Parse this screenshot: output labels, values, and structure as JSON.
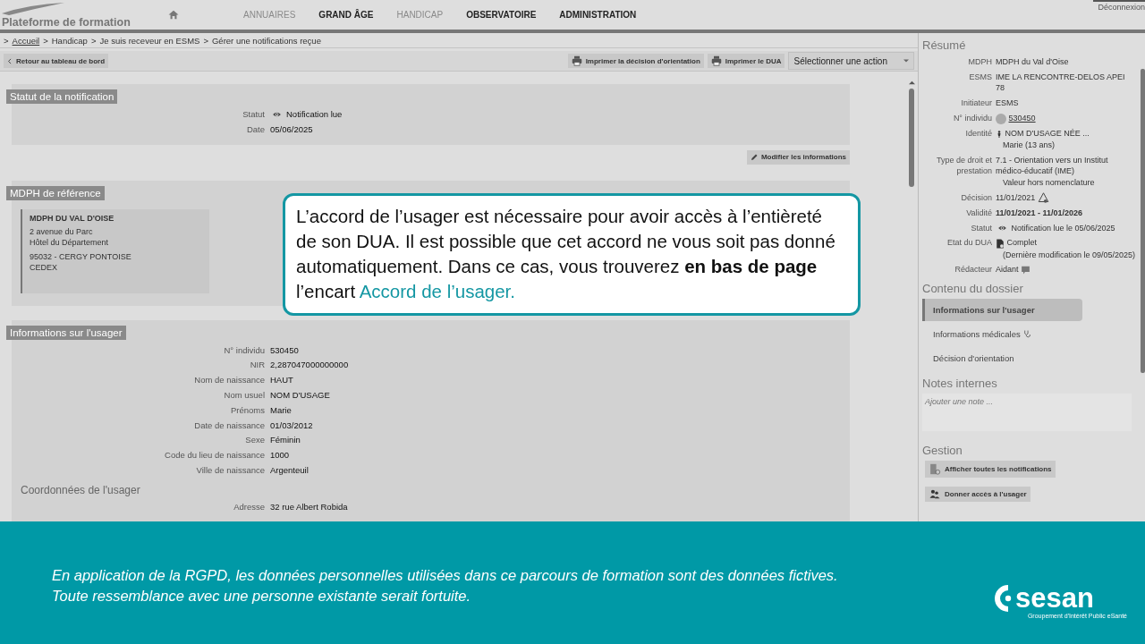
{
  "header": {
    "subtitle": "Plateforme de formation",
    "nav": [
      {
        "label": "ANNUAIRES",
        "muted": true
      },
      {
        "label": "GRAND ÂGE",
        "muted": false
      },
      {
        "label": "HANDICAP",
        "muted": true
      },
      {
        "label": "OBSERVATOIRE",
        "muted": false
      },
      {
        "label": "ADMINISTRATION",
        "muted": false
      }
    ],
    "logout": "Déconnexion"
  },
  "breadcrumb": {
    "separator": ">",
    "items": [
      {
        "label": "Accueil",
        "link": true
      },
      {
        "label": "Handicap",
        "link": false
      },
      {
        "label": "Je suis receveur en ESMS",
        "link": false
      },
      {
        "label": "Gérer une notifications reçue",
        "link": false
      }
    ]
  },
  "toolbar": {
    "back": "Retour au tableau de bord",
    "actions": [
      "Imprimer la décision d'orientation",
      "Imprimer le DUA"
    ],
    "select": "Sélectionner une action"
  },
  "sections": [
    {
      "title": "Statut de la notification",
      "kind": "fields",
      "fields": [
        {
          "kind": "eye",
          "label": "Statut",
          "value": "Notification lue"
        },
        {
          "kind": "field",
          "label": "Date",
          "value": "05/06/2025"
        }
      ],
      "button": "Modifier les informations"
    },
    {
      "title": "MDPH de référence",
      "kind": "address",
      "name": "MDPH DU VAL D'OISE",
      "lines": [
        "2 avenue du Parc",
        "Hôtel du Département",
        "95032 - CERGY PONTOISE",
        "CEDEX"
      ]
    },
    {
      "title": "Informations sur l'usager",
      "kind": "fields",
      "fields": [
        {
          "kind": "field",
          "label": "N° individu",
          "value": "530450"
        },
        {
          "kind": "field",
          "label": "NIR",
          "value": "2,287047000000000"
        },
        {
          "kind": "field",
          "label": "Nom de naissance",
          "value": "HAUT"
        },
        {
          "kind": "field",
          "label": "Nom usuel",
          "value": "NOM D'USAGE"
        },
        {
          "kind": "field",
          "label": "Prénoms",
          "value": "Marie"
        },
        {
          "kind": "field",
          "label": "Date de naissance",
          "value": "01/03/2012"
        },
        {
          "kind": "field",
          "label": "Sexe",
          "value": "Féminin"
        },
        {
          "kind": "field",
          "label": "Code du lieu de naissance",
          "value": "1000"
        },
        {
          "kind": "field",
          "label": "Ville de naissance",
          "value": "Argenteuil"
        },
        {
          "kind": "subheading",
          "label": "Coordonnées de l'usager"
        },
        {
          "kind": "field",
          "label": "Adresse",
          "value": "32 rue Albert Robida"
        }
      ]
    }
  ],
  "callout": {
    "parts": [
      {
        "kind": "plain",
        "text": "L’accord de l’usager est nécessaire pour avoir accès à l’entièreté de son DUA. Il est possible que cet accord ne vous soit pas donné automatiquement. Dans ce cas, vous trouverez "
      },
      {
        "kind": "bold",
        "text": "en bas de page"
      },
      {
        "kind": "plain",
        "text": " l’encart "
      },
      {
        "kind": "accent",
        "text": "Accord de l’usager."
      }
    ]
  },
  "sidebar": {
    "summary_title": "Résumé",
    "summary": [
      {
        "kind": "text",
        "label": "MDPH",
        "value": "MDPH du Val d'Oise"
      },
      {
        "kind": "text",
        "label": "ESMS",
        "value": "IME LA RENCONTRE-DELOS APEI 78"
      },
      {
        "kind": "text",
        "label": "Initiateur",
        "value": "ESMS"
      },
      {
        "kind": "avatar-link",
        "label": "N° individu",
        "value": "530450"
      },
      {
        "kind": "person",
        "label": "Identité",
        "value": "NOM D'USAGE NÉE ...",
        "note": "Marie (13 ans)"
      },
      {
        "kind": "stacked",
        "label": "Type de droit et prestation",
        "value": "7.1 - Orientation vers un Institut médico-éducatif (IME)",
        "note": "Valeur hors nomenclature"
      },
      {
        "kind": "warning",
        "label": "Décision",
        "value": "11/01/2021"
      },
      {
        "kind": "bold",
        "label": "Validité",
        "value": "11/01/2021 - 11/01/2026"
      },
      {
        "kind": "eye",
        "label": "Statut",
        "value": "Notification lue le 05/06/2025"
      },
      {
        "kind": "document",
        "label": "Etat du DUA",
        "value": "Complet",
        "note": "(Dernière modification le 09/05/2025)"
      },
      {
        "kind": "comment",
        "label": "Rédacteur",
        "value": "Aidant"
      }
    ],
    "contents_title": "Contenu du dossier",
    "contents": [
      {
        "kind": "plain",
        "label": "Informations sur l'usager",
        "selected": true
      },
      {
        "kind": "medical",
        "label": "Informations médicales",
        "selected": false
      },
      {
        "kind": "plain",
        "label": "Décision d'orientation",
        "selected": false
      }
    ],
    "notes_title": "Notes internes",
    "notes": {
      "placeholder": "Ajouter une note ..."
    },
    "management_title": "Gestion",
    "management": [
      {
        "kind": "notifications",
        "label": "Afficher toutes les notifications"
      },
      {
        "kind": "users",
        "label": "Donner accès à l'usager"
      }
    ]
  },
  "footer": {
    "lines": [
      "En application de la RGPD, les données personnelles utilisées dans ce parcours de formation sont des données fictives.",
      "Toute ressemblance avec une personne existante serait fortuite."
    ],
    "logo_name": "sesan",
    "logo_tagline": "Groupement d'Intérêt Public eSanté"
  }
}
